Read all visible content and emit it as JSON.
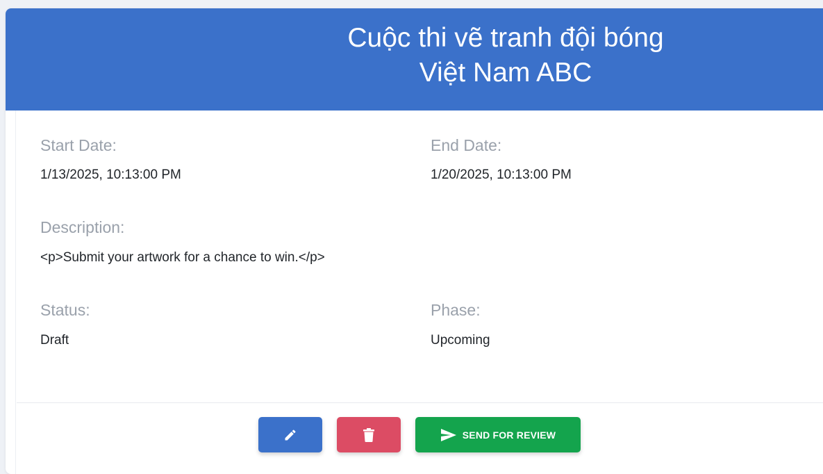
{
  "header": {
    "title_line1": "Cuộc thi vẽ tranh đội bóng",
    "title_line2": "Việt Nam ABC"
  },
  "fields": {
    "start_date": {
      "label": "Start Date:",
      "value": "1/13/2025, 10:13:00 PM"
    },
    "end_date": {
      "label": "End Date:",
      "value": "1/20/2025, 10:13:00 PM"
    },
    "description": {
      "label": "Description:",
      "value": "<p>Submit your artwork for a chance to win.</p>"
    },
    "status": {
      "label": "Status:",
      "value": "Draft"
    },
    "phase": {
      "label": "Phase:",
      "value": "Upcoming"
    }
  },
  "actions": {
    "edit_icon": "pencil-icon",
    "delete_icon": "trash-icon",
    "review_icon": "send-icon",
    "review_label": "SEND FOR REVIEW"
  },
  "colors": {
    "header": "#3b71ca",
    "edit": "#3b71ca",
    "delete": "#dc4c64",
    "review": "#14a44d"
  }
}
